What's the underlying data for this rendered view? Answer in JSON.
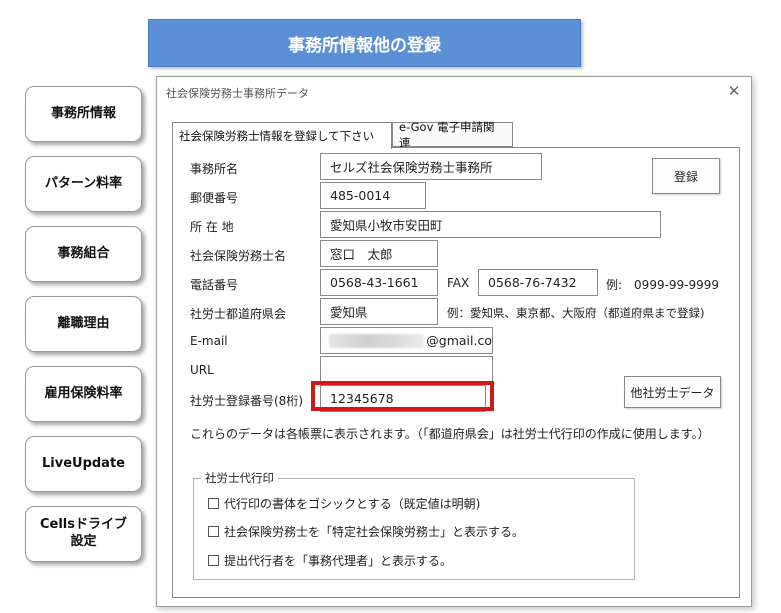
{
  "banner": {
    "title": "事務所情報他の登録"
  },
  "sidebar": {
    "buttons": [
      {
        "label": "事務所情報"
      },
      {
        "label": "パターン料率"
      },
      {
        "label": "事務組合"
      },
      {
        "label": "離職理由"
      },
      {
        "label": "雇用保険料率"
      },
      {
        "label": "LiveUpdate"
      },
      {
        "label_line1": "Cellsドライブ",
        "label_line2": "設定"
      }
    ]
  },
  "dialog": {
    "title": "社会保険労務士事務所データ",
    "close_glyph": "✕",
    "tabs": [
      {
        "label": "社会保険労務士情報を登録して下さい"
      },
      {
        "label": "e-Gov 電子申請関連"
      }
    ],
    "form": {
      "office_name": {
        "label": "事務所名",
        "value": "セルズ社会保険労務士事務所"
      },
      "postal_code": {
        "label": "郵便番号",
        "value": "485-0014"
      },
      "address": {
        "label": "所 在 地",
        "value": "愛知県小牧市安田町"
      },
      "sharoushi_name": {
        "label": "社会保険労務士名",
        "value": "窓口　太郎"
      },
      "phone": {
        "label": "電話番号",
        "value": "0568-43-1661"
      },
      "fax": {
        "label": "FAX",
        "value": "0568-76-7432",
        "hint": "例:　0999-99-9999"
      },
      "prefecture": {
        "label": "社労士都道府県会",
        "value": "愛知県",
        "hint": "例：愛知県、東京都、大阪府（都道府県まで登録)"
      },
      "email": {
        "label": "E-mail",
        "value_suffix": "@gmail.co"
      },
      "url": {
        "label": "URL",
        "value": ""
      },
      "registration_no": {
        "label": "社労士登録番号(8桁)",
        "value": "12345678"
      },
      "note": "これらのデータは各帳票に表示されます。（「都道府県会」は社労士代行印の作成に使用します。）"
    },
    "buttons": {
      "register": "登録",
      "other_data": "他社労士データ"
    },
    "seal_group": {
      "title": "社労士代行印",
      "options": [
        {
          "label": "代行印の書体をゴシックとする（既定値は明朝)",
          "checked": false
        },
        {
          "label": "社会保険労務士を「特定社会保険労務士」と表示する。",
          "checked": false
        },
        {
          "label": "提出代行者を「事務代理者」と表示する。",
          "checked": false
        }
      ]
    }
  },
  "colors": {
    "banner_bg": "#5b8fd6",
    "highlight_border": "#d01818"
  }
}
